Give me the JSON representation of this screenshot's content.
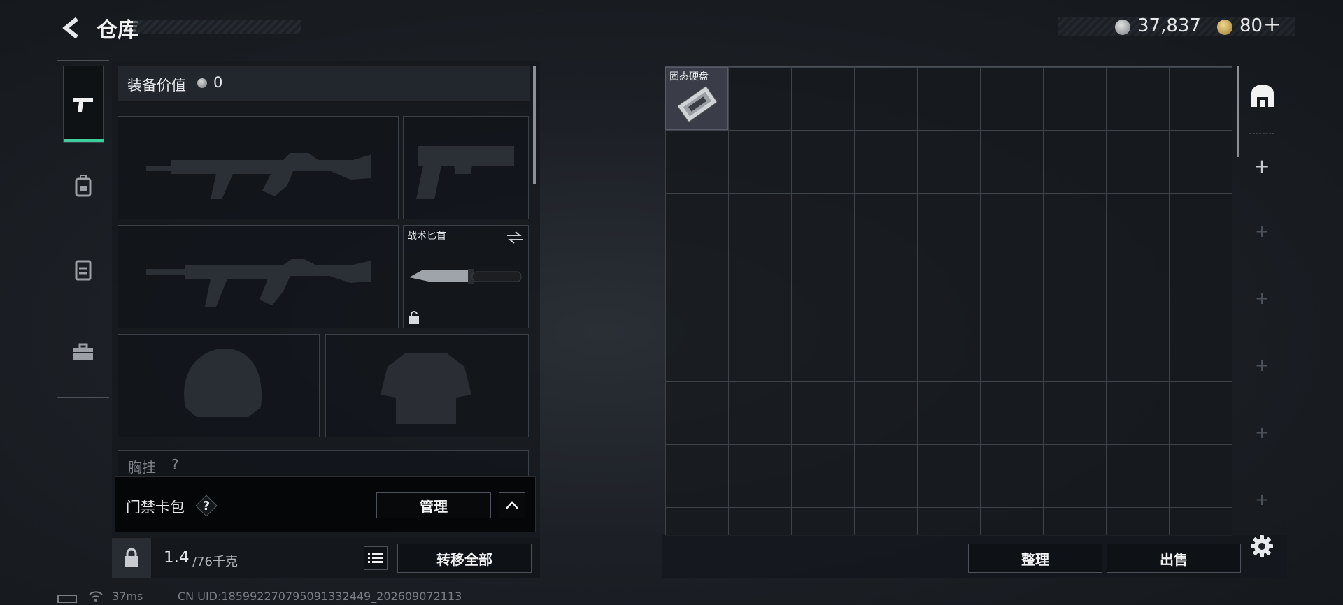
{
  "header": {
    "title": "仓库"
  },
  "currency": {
    "silver_amount": "37,837",
    "gold_amount": "80"
  },
  "loadout": {
    "equipment_value_label": "装备价值",
    "equipment_value": "0",
    "knife_slot_label": "战术匕首",
    "chest_rig_label": "胸挂",
    "chest_rig_icon_text": "?"
  },
  "keycard": {
    "label": "门禁卡包",
    "help": "?",
    "manage_label": "管理"
  },
  "weight": {
    "current": "1.4",
    "limit": "/76千克"
  },
  "actions": {
    "transfer_all": "转移全部",
    "organize": "整理",
    "sell": "出售"
  },
  "stash": {
    "item_label": "固态硬盘"
  },
  "status": {
    "ping": "37ms",
    "uid": "CN UID:185992270795091332449_202609072113"
  },
  "colors": {
    "accent_active": "#3ccf9b",
    "tile_item_bg": "#3a3c47"
  }
}
